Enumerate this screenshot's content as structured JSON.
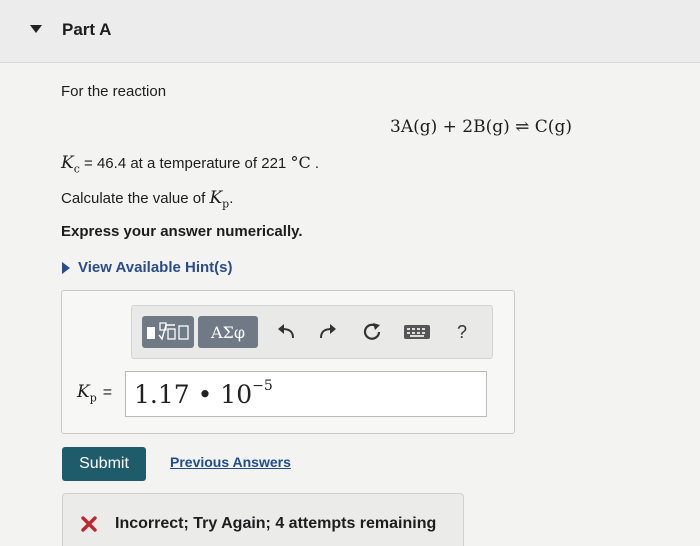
{
  "header": {
    "part_label": "Part A"
  },
  "question": {
    "intro": "For the reaction",
    "reaction": "3A(g) + 2B(g) ⇌ C(g)",
    "kc_symbol": "K",
    "kc_subscript": "c",
    "kc_text": " = 46.4 at a temperature of 221 ",
    "kc_unit": "°C",
    "kc_end": " .",
    "calc_text": "Calculate the value of ",
    "kp_symbol": "K",
    "kp_subscript": "p",
    "calc_end": ".",
    "instruction": "Express your answer numerically."
  },
  "hint": {
    "label": "View Available Hint(s)"
  },
  "toolbar": {
    "greek_label": "ΑΣφ",
    "help_label": "?"
  },
  "answer": {
    "label_symbol": "K",
    "label_subscript": "p",
    "label_eq": "=",
    "mantissa": "1.17",
    "times": " • 10",
    "exponent": "−5"
  },
  "actions": {
    "submit_label": "Submit",
    "previous_label": "Previous Answers"
  },
  "feedback": {
    "text": "Incorrect; Try Again; 4 attempts remaining",
    "color": "#c0262d"
  }
}
